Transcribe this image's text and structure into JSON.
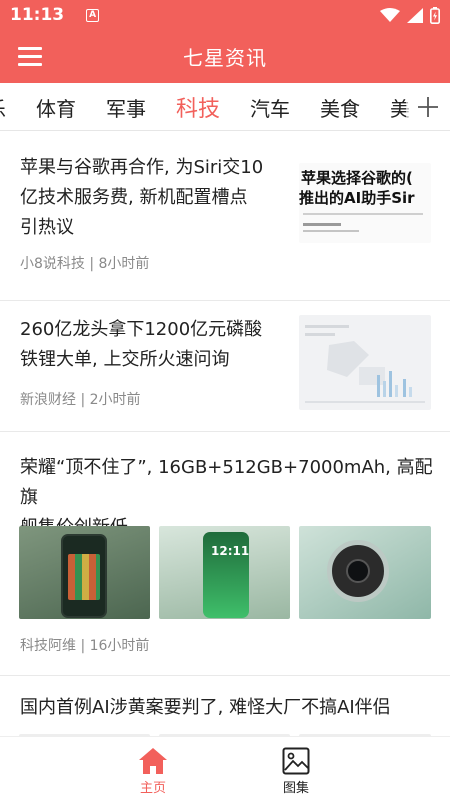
{
  "status_bar": {
    "time": "11:13",
    "notification_badge": "A"
  },
  "app_bar": {
    "title": "七星资讯",
    "menu_icon": "hamburger-menu-icon"
  },
  "tabs": {
    "items": [
      "乐",
      "体育",
      "军事",
      "科技",
      "汽车",
      "美食",
      "美"
    ],
    "active": "科技",
    "add_icon": "plus-icon"
  },
  "articles": [
    {
      "title_line1": "苹果与谷歌再合作, 为Siri交10",
      "title_line2": "亿技术服务费, 新机配置槽点",
      "title_line3": "引热议",
      "source_time": "小8说科技 | 8小时前",
      "thumb_line1": "苹果选择谷歌的(",
      "thumb_line2": "推出的AI助手Sir"
    },
    {
      "title_line1": "260亿龙头拿下1200亿元磷酸",
      "title_line2": "铁锂大单, 上交所火速问询",
      "source_time": "新浪财经 | 2小时前"
    },
    {
      "title_line1": "荣耀“顶不住了”, 16GB+512GB+7000mAh, 高配旗",
      "title_line2": "舰售价创新低",
      "source_time": "科技阿维 | 16小时前",
      "phone_time": "12:11"
    },
    {
      "title_line1": "国内首例AI涉黄案要判了, 难怪大厂不搞AI伴侣"
    }
  ],
  "bottom_nav": {
    "items": [
      {
        "label": "主页",
        "icon": "home-icon",
        "active": true
      },
      {
        "label": "图集",
        "icon": "gallery-icon",
        "active": false
      }
    ]
  },
  "colors": {
    "brand": "#f2605b",
    "text": "#222222",
    "meta": "#8a8a8a"
  }
}
